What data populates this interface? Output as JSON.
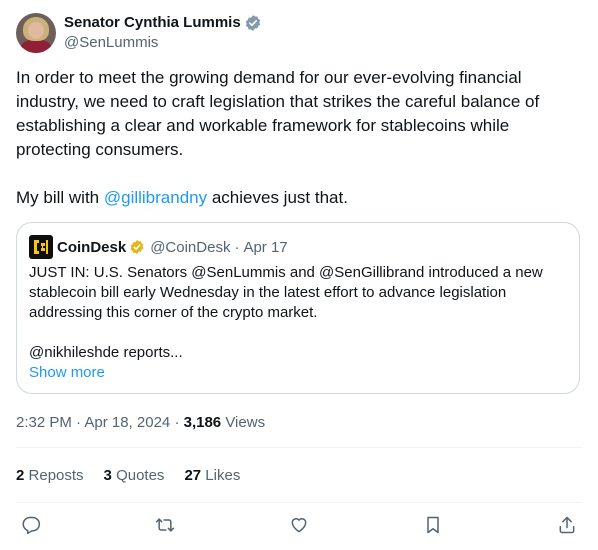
{
  "author": {
    "display_name": "Senator Cynthia Lummis",
    "handle": "@SenLummis"
  },
  "tweet": {
    "paragraph1": "In order to meet the growing demand for our ever-evolving financial industry, we need to craft legislation that strikes the careful balance of establishing a clear and workable framework for stablecoins while protecting consumers.",
    "paragraph2_prefix": "My bill with ",
    "paragraph2_mention": "@gillibrandny",
    "paragraph2_suffix": " achieves just that."
  },
  "quote": {
    "name": "CoinDesk",
    "handle": "@CoinDesk",
    "separator": "·",
    "date": "Apr 17",
    "text1": "JUST IN: U.S. Senators @SenLummis and @SenGillibrand introduced a new stablecoin bill early Wednesday in the latest effort to advance legislation addressing this corner of the crypto market.",
    "text2": "@nikhileshde reports...",
    "show_more": "Show more"
  },
  "meta": {
    "time_date": "2:32 PM · Apr 18, 2024",
    "separator": "·",
    "views_count": "3,186",
    "views_label": "Views"
  },
  "stats": {
    "reposts_count": "2",
    "reposts_label": "Reposts",
    "quotes_count": "3",
    "quotes_label": "Quotes",
    "likes_count": "27",
    "likes_label": "Likes"
  },
  "colors": {
    "accent": "#1d9bf0",
    "secondary_text": "#536471",
    "verified_gold": "#e2b719"
  },
  "icons": [
    "verified-badge-icon",
    "gold-verified-badge-icon",
    "reply-icon",
    "repost-icon",
    "like-icon",
    "bookmark-icon",
    "share-icon"
  ]
}
